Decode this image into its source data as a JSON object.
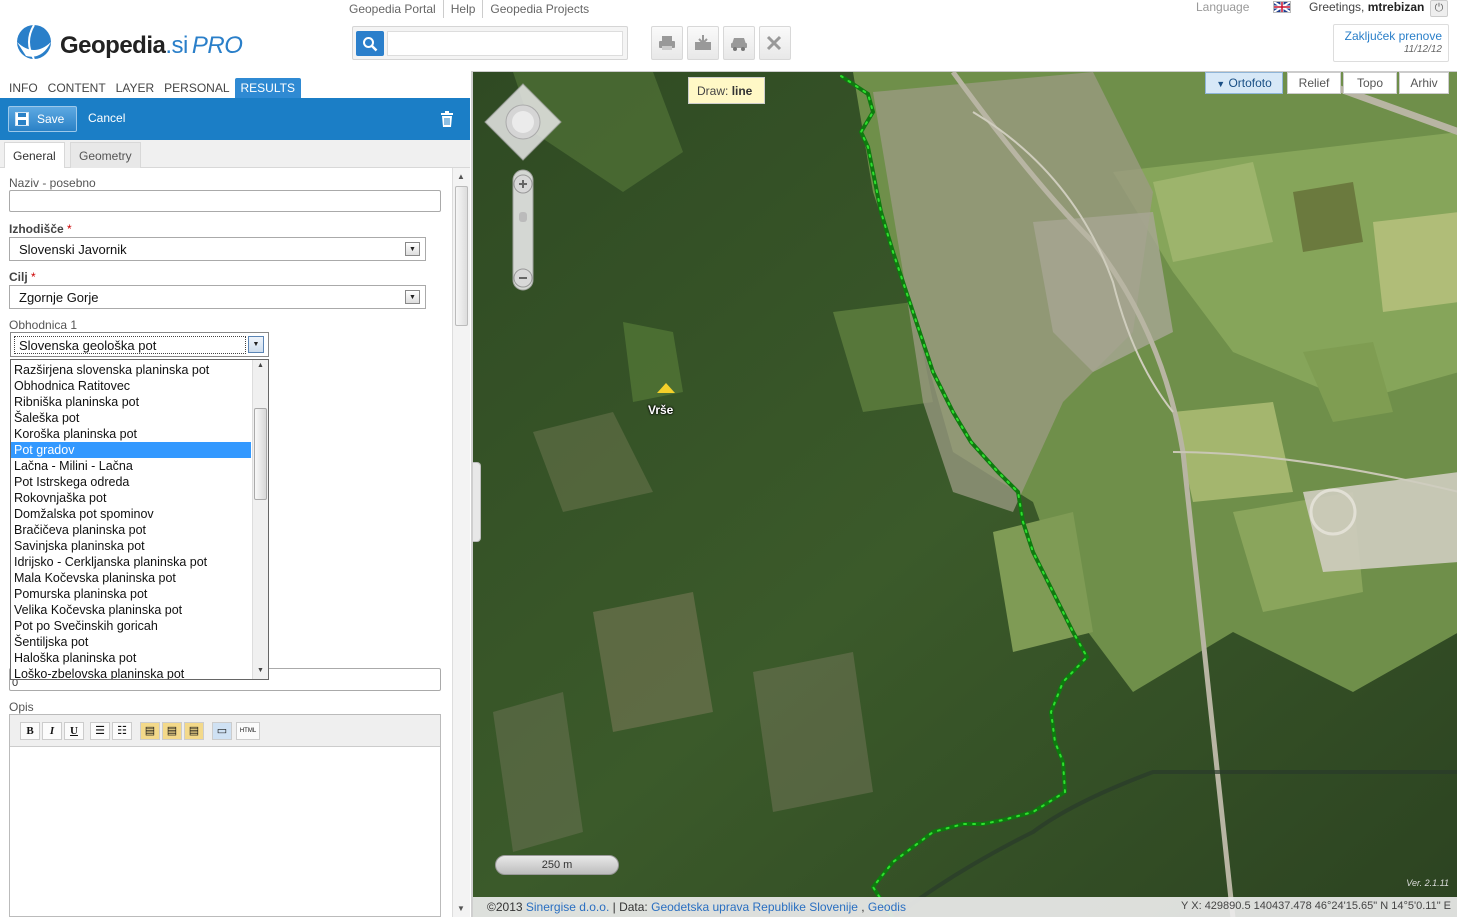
{
  "header": {
    "logo_text": "Geopedia",
    "logo_si": ".si",
    "logo_pro": "PRO",
    "top_links": [
      "Geopedia Portal",
      "Help",
      "Geopedia Projects"
    ],
    "search_placeholder": "",
    "language_label": "Language",
    "greeting_prefix": "Greetings,",
    "greeting_user": "mtrebizan",
    "renewal_title": "Zaključek prenove",
    "renewal_date": "11/12/12"
  },
  "main_tabs": [
    "INFO",
    "CONTENT",
    "LAYER",
    "PERSONAL",
    "RESULTS"
  ],
  "active_main_tab": "RESULTS",
  "results_bar": {
    "save_label": "Save",
    "cancel_label": "Cancel"
  },
  "sub_tabs": [
    "General",
    "Geometry"
  ],
  "form": {
    "naziv_label": "Naziv - posebno",
    "naziv_value": "",
    "izhodisce_label": "Izhodišče",
    "izhodisce_value": "Slovenski Javornik",
    "cilj_label": "Cilj",
    "cilj_value": "Zgornje Gorje",
    "obhodnica_label": "Obhodnica 1",
    "obhodnica_value": "Slovenska geološka pot",
    "hidden_field_value": "0",
    "opis_label": "Opis",
    "required_mark": "*"
  },
  "dropdown_options": [
    "Razširjena slovenska planinska pot",
    "Obhodnica Ratitovec",
    "Ribniška planinska pot",
    "Šaleška pot",
    "Koroška planinska pot",
    "Pot gradov",
    "Lačna - Milini - Lačna",
    "Pot Istrskega odreda",
    "Rokovnjaška pot",
    "Domžalska pot spominov",
    "Bračičeva planinska pot",
    "Savinjska planinska pot",
    "Idrijsko - Cerkljanska planinska pot",
    "Mala Kočevska planinska pot",
    "Pomurska planinska pot",
    "Velika Kočevska planinska pot",
    "Pot po Svečinskih goricah",
    "Šentiljska pot",
    "Haloška planinska pot",
    "Loško-zbelovska planinska pot"
  ],
  "selected_option_index": 5,
  "editor_buttons": [
    "B",
    "I",
    "U",
    "bulleted-list",
    "numbered-list",
    "paste",
    "paste-text",
    "paste-word",
    "source",
    "HTML"
  ],
  "map": {
    "draw_tooltip_prefix": "Draw:",
    "draw_tooltip_mode": "line",
    "layers": [
      "Ortofoto",
      "Relief",
      "Topo",
      "Arhiv"
    ],
    "active_layer": "Ortofoto",
    "place_label": "Vrše",
    "scale_label": "250 m",
    "footer_copyright": "©2013",
    "footer_company": "Sinergise d.o.o.",
    "footer_data_label": "Data:",
    "footer_data_source1": "Geodetska uprava Republike Slovenije",
    "footer_data_source2": "Geodis",
    "coordinates": "Y X: 429890.5 140437.478    46°24'15.65\" N 14°5'0.11\" E",
    "version": "Ver. 2.1.11"
  },
  "colors": {
    "accent_blue": "#1b7ec6",
    "route_green": "#22dd22",
    "selected_option": "#3399ff"
  }
}
